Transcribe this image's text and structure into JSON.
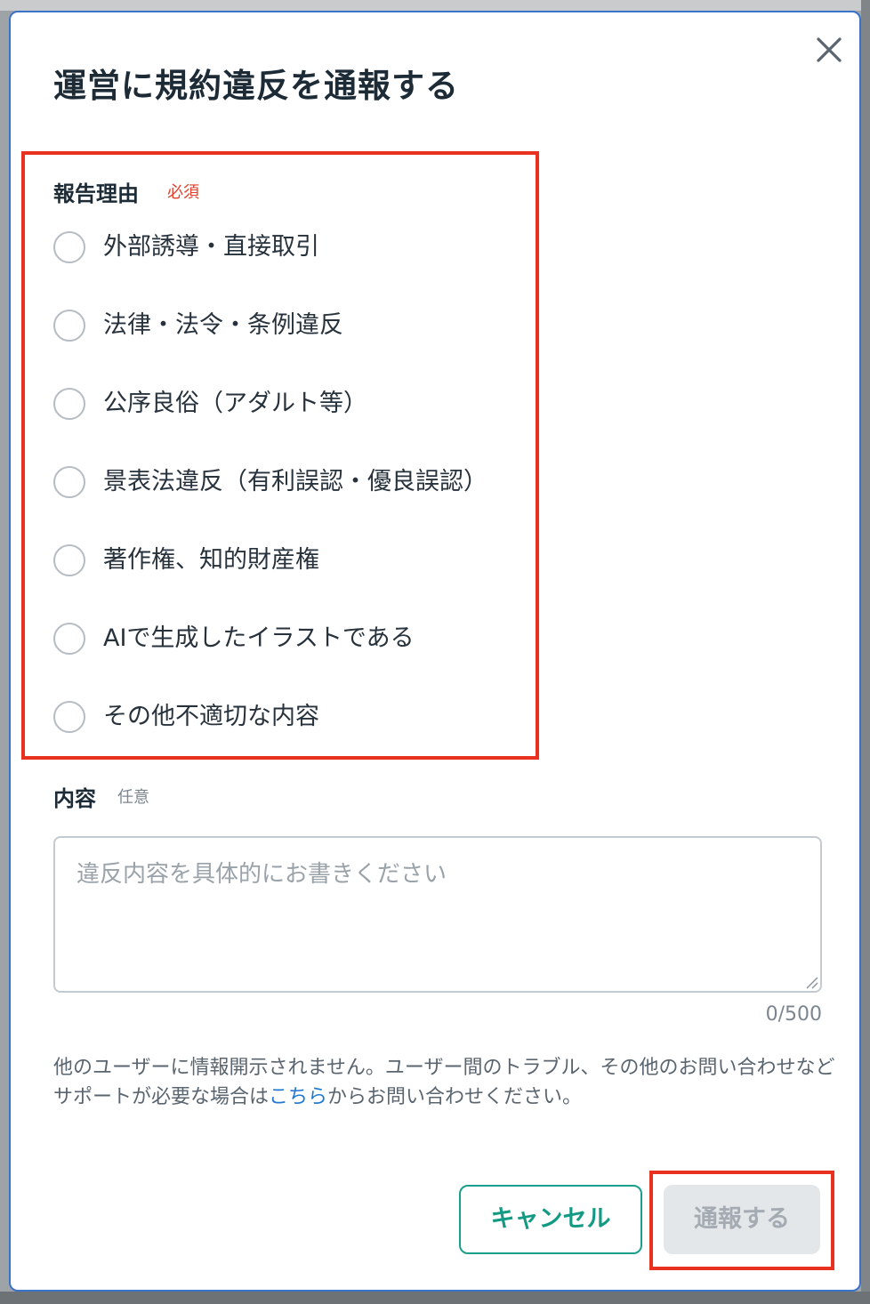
{
  "dialog": {
    "title": "運営に規約違反を通報する",
    "close_icon": "close-icon"
  },
  "reason": {
    "label": "報告理由",
    "required_tag": "必須",
    "options": [
      {
        "label": "外部誘導・直接取引"
      },
      {
        "label": "法律・法令・条例違反"
      },
      {
        "label": "公序良俗（アダルト等）"
      },
      {
        "label": "景表法違反（有利誤認・優良誤認）"
      },
      {
        "label": "著作権、知的財産権"
      },
      {
        "label": "AIで生成したイラストである"
      },
      {
        "label": "その他不適切な内容"
      }
    ],
    "selected": null
  },
  "content": {
    "label": "内容",
    "optional_tag": "任意",
    "placeholder": "違反内容を具体的にお書きください",
    "value": "",
    "char_count": "0/500"
  },
  "notice": {
    "text_before": "他のユーザーに情報開示されません。ユーザー間のトラブル、その他のお問い合わせなどサポートが必要な場合は",
    "link_text": "こちら",
    "text_after": "からお問い合わせください。"
  },
  "actions": {
    "cancel_label": "キャンセル",
    "submit_label": "通報する",
    "submit_enabled": false
  },
  "colors": {
    "accent": "#129a84",
    "required": "#e2402c",
    "link": "#1f78d1",
    "highlight": "#e8311f",
    "modal_border": "#3b73c9"
  }
}
